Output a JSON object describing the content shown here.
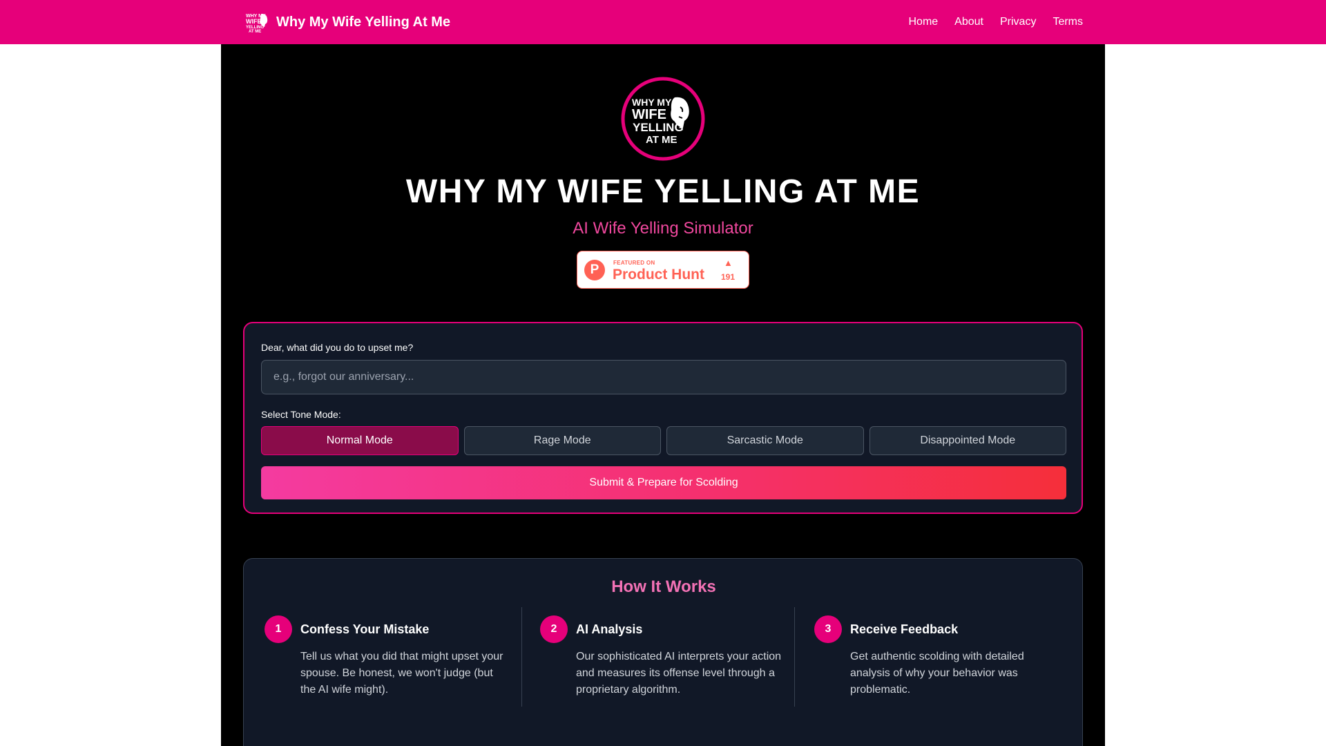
{
  "header": {
    "site_name": "Why My Wife Yelling At Me",
    "logo_icon": "wife-yelling-logo-icon",
    "nav": [
      {
        "label": "Home"
      },
      {
        "label": "About"
      },
      {
        "label": "Privacy"
      },
      {
        "label": "Terms"
      }
    ]
  },
  "hero": {
    "logo_text": [
      "WHY MY",
      "WIFE",
      "YELLING",
      "AT ME"
    ],
    "title": "WHY MY WIFE YELLING AT ME",
    "subtitle": "AI Wife Yelling Simulator"
  },
  "product_hunt": {
    "featured": "FEATURED ON",
    "name": "Product Hunt",
    "letter": "P",
    "upvote_icon": "triangle-up-icon",
    "count": "191"
  },
  "form": {
    "question_label": "Dear, what did you do to upset me?",
    "input_value": "",
    "input_placeholder": "e.g., forgot our anniversary...",
    "tone_label": "Select Tone Mode:",
    "tones": [
      {
        "label": "Normal Mode",
        "selected": true
      },
      {
        "label": "Rage Mode",
        "selected": false
      },
      {
        "label": "Sarcastic Mode",
        "selected": false
      },
      {
        "label": "Disappointed Mode",
        "selected": false
      }
    ],
    "submit_label": "Submit & Prepare for Scolding"
  },
  "how_it_works": {
    "title": "How It Works",
    "steps": [
      {
        "number": "1",
        "title": "Confess Your Mistake",
        "description": "Tell us what you did that might upset your spouse. Be honest, we won't judge (but the AI wife might)."
      },
      {
        "number": "2",
        "title": "AI Analysis",
        "description": "Our sophisticated AI interprets your action and measures its offense level through a proprietary algorithm."
      },
      {
        "number": "3",
        "title": "Receive Feedback",
        "description": "Get authentic scolding with detailed analysis of why your behavior was problematic."
      }
    ]
  },
  "colors": {
    "brand_pink": "#e6007a",
    "accent_pink": "#f0489e",
    "product_hunt": "#ff6154",
    "card_bg": "#111827"
  }
}
